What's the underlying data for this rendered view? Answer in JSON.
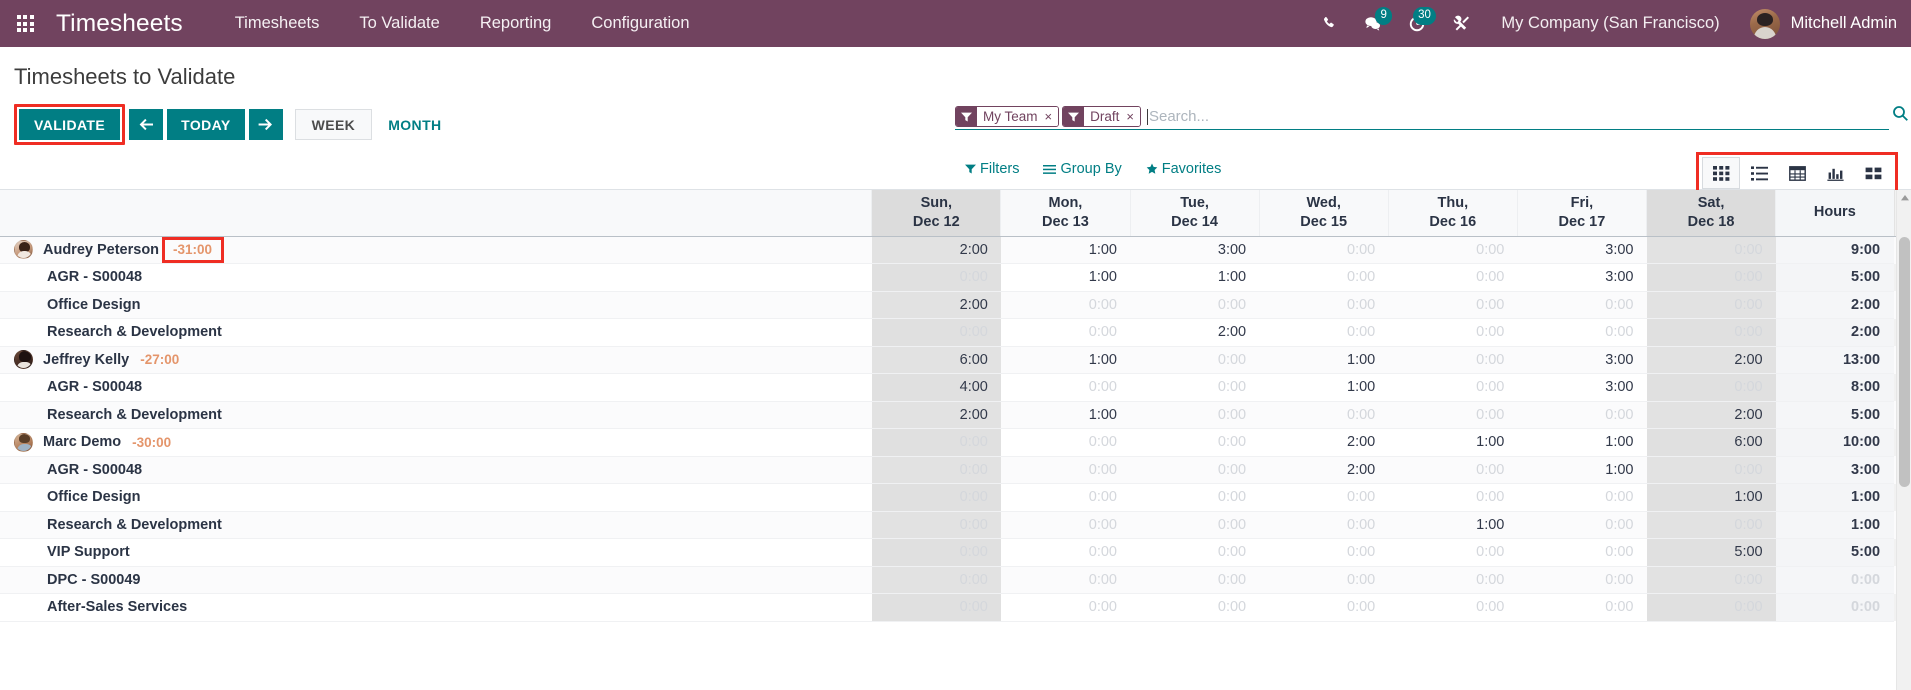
{
  "navbar": {
    "apps_icon": "apps-grid-icon",
    "brand": "Timesheets",
    "menu": [
      {
        "label": "Timesheets"
      },
      {
        "label": "To Validate"
      },
      {
        "label": "Reporting"
      },
      {
        "label": "Configuration"
      }
    ],
    "system_icons": [
      {
        "name": "phone-icon",
        "badge": null
      },
      {
        "name": "messages-icon",
        "badge": "9"
      },
      {
        "name": "activities-clock-icon",
        "badge": "30"
      },
      {
        "name": "debug-tools-icon",
        "badge": null
      }
    ],
    "company": "My Company (San Francisco)",
    "user": "Mitchell Admin",
    "brand_color": "#71435f",
    "accent_color": "#017e84"
  },
  "control_panel": {
    "breadcrumb": "Timesheets to Validate",
    "validate_label": "VALIDATE",
    "prev_label": "←",
    "today_label": "TODAY",
    "next_label": "→",
    "week_label": "WEEK",
    "month_label": "MONTH",
    "highlight_color": "#ef2d23"
  },
  "search": {
    "facets": [
      {
        "type_icon": "filter-icon",
        "value": "My Team",
        "remove": "×"
      },
      {
        "type_icon": "filter-icon",
        "value": "Draft",
        "remove": "×"
      }
    ],
    "placeholder": "Search...",
    "value": "",
    "magnifier_icon": "search-icon"
  },
  "dropdowns": [
    {
      "icon": "filter-icon",
      "label": "Filters"
    },
    {
      "icon": "group-by-icon",
      "label": "Group By"
    },
    {
      "icon": "star-icon",
      "label": "Favorites"
    }
  ],
  "view_switcher": {
    "buttons": [
      {
        "name": "grid-view-icon",
        "active": true
      },
      {
        "name": "list-view-icon",
        "active": false
      },
      {
        "name": "pivot-view-icon",
        "active": false
      },
      {
        "name": "graph-view-icon",
        "active": false
      },
      {
        "name": "kanban-view-icon",
        "active": false
      }
    ]
  },
  "grid": {
    "columns": [
      {
        "dow": "Sun,",
        "date": "Dec 12",
        "weekend": true
      },
      {
        "dow": "Mon,",
        "date": "Dec 13",
        "weekend": false
      },
      {
        "dow": "Tue,",
        "date": "Dec 14",
        "weekend": false
      },
      {
        "dow": "Wed,",
        "date": "Dec 15",
        "weekend": false
      },
      {
        "dow": "Thu,",
        "date": "Dec 16",
        "weekend": false
      },
      {
        "dow": "Fri,",
        "date": "Dec 17",
        "weekend": false
      },
      {
        "dow": "Sat,",
        "date": "Dec 18",
        "weekend": true
      }
    ],
    "total_header": "Hours",
    "rows": [
      {
        "kind": "employee",
        "avatar": "avatar-audrey-peterson",
        "label": "Audrey Peterson",
        "diff": "-31:00",
        "diff_highlighted": true,
        "values": [
          "2:00",
          "1:00",
          "3:00",
          "0:00",
          "0:00",
          "3:00",
          "0:00"
        ],
        "total": "9:00"
      },
      {
        "kind": "task",
        "label": "AGR - S00048",
        "values": [
          "0:00",
          "1:00",
          "1:00",
          "0:00",
          "0:00",
          "3:00",
          "0:00"
        ],
        "total": "5:00"
      },
      {
        "kind": "task",
        "label": "Office Design",
        "values": [
          "2:00",
          "0:00",
          "0:00",
          "0:00",
          "0:00",
          "0:00",
          "0:00"
        ],
        "total": "2:00"
      },
      {
        "kind": "task",
        "label": "Research & Development",
        "values": [
          "0:00",
          "0:00",
          "2:00",
          "0:00",
          "0:00",
          "0:00",
          "0:00"
        ],
        "total": "2:00"
      },
      {
        "kind": "employee",
        "avatar": "avatar-jeffrey-kelly",
        "label": "Jeffrey Kelly",
        "diff": "-27:00",
        "diff_highlighted": false,
        "values": [
          "6:00",
          "1:00",
          "0:00",
          "1:00",
          "0:00",
          "3:00",
          "2:00"
        ],
        "total": "13:00"
      },
      {
        "kind": "task",
        "label": "AGR - S00048",
        "values": [
          "4:00",
          "0:00",
          "0:00",
          "1:00",
          "0:00",
          "3:00",
          "0:00"
        ],
        "total": "8:00"
      },
      {
        "kind": "task",
        "label": "Research & Development",
        "values": [
          "2:00",
          "1:00",
          "0:00",
          "0:00",
          "0:00",
          "0:00",
          "2:00"
        ],
        "total": "5:00"
      },
      {
        "kind": "employee",
        "avatar": "avatar-marc-demo",
        "label": "Marc Demo",
        "diff": "-30:00",
        "diff_highlighted": false,
        "values": [
          "0:00",
          "0:00",
          "0:00",
          "2:00",
          "1:00",
          "1:00",
          "6:00"
        ],
        "total": "10:00"
      },
      {
        "kind": "task",
        "label": "AGR - S00048",
        "values": [
          "0:00",
          "0:00",
          "0:00",
          "2:00",
          "0:00",
          "1:00",
          "0:00"
        ],
        "total": "3:00"
      },
      {
        "kind": "task",
        "label": "Office Design",
        "values": [
          "0:00",
          "0:00",
          "0:00",
          "0:00",
          "0:00",
          "0:00",
          "1:00"
        ],
        "total": "1:00"
      },
      {
        "kind": "task",
        "label": "Research & Development",
        "values": [
          "0:00",
          "0:00",
          "0:00",
          "0:00",
          "1:00",
          "0:00",
          "0:00"
        ],
        "total": "1:00"
      },
      {
        "kind": "task",
        "label": "VIP Support",
        "values": [
          "0:00",
          "0:00",
          "0:00",
          "0:00",
          "0:00",
          "0:00",
          "5:00"
        ],
        "total": "5:00"
      },
      {
        "kind": "task",
        "label": "DPC - S00049",
        "values": [
          "0:00",
          "0:00",
          "0:00",
          "0:00",
          "0:00",
          "0:00",
          "0:00"
        ],
        "total": "0:00"
      },
      {
        "kind": "task",
        "label": "After-Sales Services",
        "values": [
          "0:00",
          "0:00",
          "0:00",
          "0:00",
          "0:00",
          "0:00",
          "0:00"
        ],
        "total": "0:00"
      }
    ]
  }
}
